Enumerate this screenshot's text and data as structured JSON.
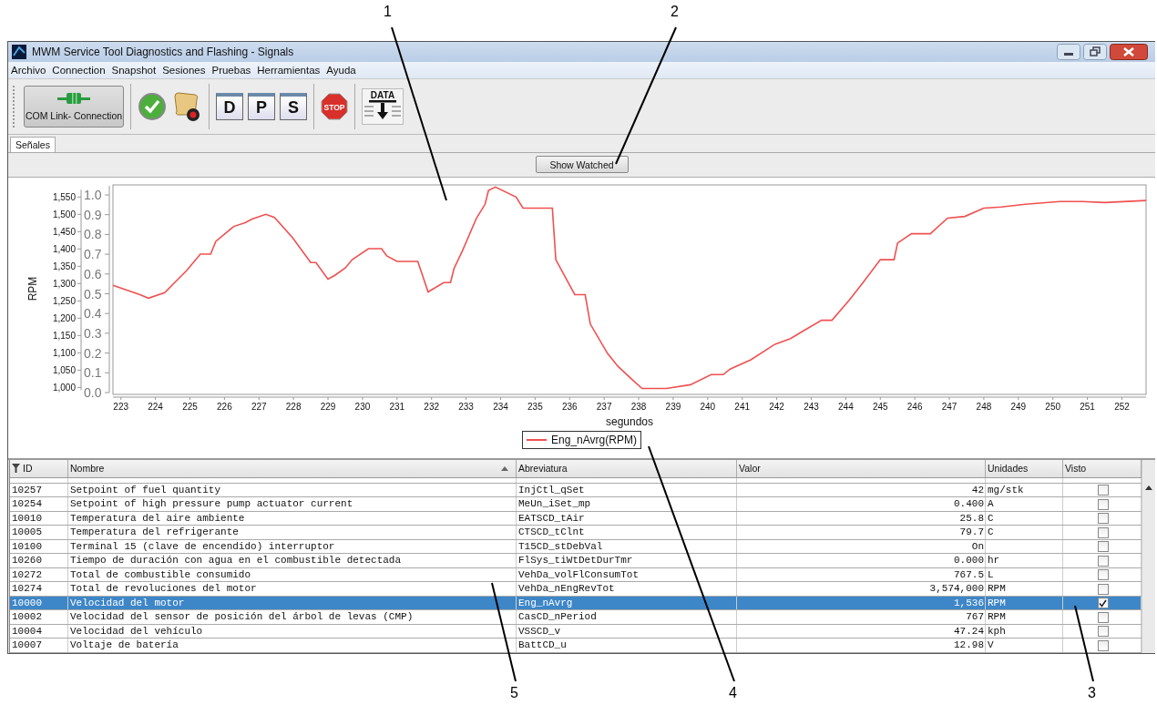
{
  "callouts": [
    {
      "label": "1"
    },
    {
      "label": "2"
    },
    {
      "label": "5"
    },
    {
      "label": "4"
    },
    {
      "label": "3"
    }
  ],
  "window": {
    "title": "MWM Service Tool Diagnostics and Flashing - Signals"
  },
  "menu": [
    "Archivo",
    "Connection",
    "Snapshot",
    "Sesiones",
    "Pruebas",
    "Herramientas",
    "Ayuda"
  ],
  "toolbar": [
    {
      "kind": "connection",
      "label": "COM Link- Connection"
    },
    {
      "kind": "check"
    },
    {
      "kind": "scroll"
    },
    {
      "kind": "letter",
      "label": "D"
    },
    {
      "kind": "letter",
      "label": "P"
    },
    {
      "kind": "letter",
      "label": "S"
    },
    {
      "kind": "stop",
      "label": "STOP"
    },
    {
      "kind": "data",
      "label": "DATA"
    }
  ],
  "tabs": [
    {
      "label": "Señales",
      "selected": true
    }
  ],
  "show_watched_button": "Show Watched",
  "chart": {
    "chart_data": {
      "type": "line",
      "xlabel": "segundos",
      "ylabel": "RPM",
      "xlim": [
        222.77,
        252.7
      ],
      "ylim": [
        980,
        1585
      ],
      "xticks": [
        223,
        224,
        225,
        226,
        227,
        228,
        229,
        230,
        231,
        232,
        233,
        234,
        235,
        236,
        237,
        238,
        239,
        240,
        241,
        242,
        243,
        244,
        245,
        246,
        247,
        248,
        249,
        250,
        251,
        252
      ],
      "yticks": [
        {
          "value": 1000,
          "label": "1,000"
        },
        {
          "value": 1050,
          "label": "1,050"
        },
        {
          "value": 1100,
          "label": "1,100"
        },
        {
          "value": 1150,
          "label": "1,150"
        },
        {
          "value": 1200,
          "label": "1,200"
        },
        {
          "value": 1250,
          "label": "1,250"
        },
        {
          "value": 1300,
          "label": "1,300"
        },
        {
          "value": 1350,
          "label": "1,350"
        },
        {
          "value": 1400,
          "label": "1,400"
        },
        {
          "value": 1450,
          "label": "1,450"
        },
        {
          "value": 1500,
          "label": "1,500"
        },
        {
          "value": 1550,
          "label": "1,550"
        }
      ],
      "y2ticks": [
        "0.0",
        "0.1",
        "0.2",
        "0.3",
        "0.4",
        "0.5",
        "0.6",
        "0.7",
        "0.8",
        "0.9",
        "1.0"
      ],
      "x": [
        222.77,
        223.55,
        223.8,
        224.27,
        224.53,
        224.9,
        225.3,
        225.6,
        225.75,
        226.27,
        226.6,
        226.8,
        227.2,
        227.45,
        227.97,
        228.5,
        228.65,
        229.0,
        229.2,
        229.5,
        229.7,
        230.17,
        230.55,
        230.7,
        231.0,
        231.6,
        231.9,
        232.35,
        232.55,
        232.65,
        232.9,
        233.3,
        233.55,
        233.65,
        233.85,
        234.45,
        234.65,
        235.5,
        235.6,
        236.15,
        236.45,
        236.6,
        237.1,
        237.4,
        237.8,
        238.1,
        238.8,
        239.5,
        240.1,
        240.45,
        240.65,
        241.25,
        241.95,
        242.4,
        242.75,
        243.3,
        243.6,
        244.1,
        244.5,
        245.0,
        245.4,
        245.5,
        245.9,
        246.45,
        246.95,
        247.45,
        248.0,
        248.5,
        249.2,
        250.2,
        250.85,
        251.5,
        252.7
      ],
      "series": [
        {
          "name": "Eng_nAvrg(RPM)",
          "color": "#f05050",
          "values": [
            1295,
            1268,
            1258,
            1274,
            1300,
            1337,
            1385,
            1385,
            1422,
            1465,
            1476,
            1486,
            1500,
            1491,
            1433,
            1361,
            1361,
            1313,
            1324,
            1345,
            1369,
            1401,
            1401,
            1380,
            1364,
            1364,
            1276,
            1303,
            1303,
            1343,
            1396,
            1489,
            1529,
            1569,
            1579,
            1550,
            1518,
            1518,
            1369,
            1268,
            1268,
            1183,
            1098,
            1061,
            1024,
            997,
            997,
            1008,
            1037,
            1037,
            1053,
            1080,
            1125,
            1141,
            1162,
            1194,
            1194,
            1252,
            1303,
            1369,
            1369,
            1417,
            1444,
            1444,
            1489,
            1494,
            1518,
            1521,
            1529,
            1537,
            1537,
            1534,
            1540
          ]
        }
      ]
    }
  },
  "table": {
    "columns": [
      "ID",
      "Nombre",
      "Abreviatura",
      "Valor",
      "Unidades",
      "Visto"
    ],
    "rows": [
      {
        "id": "10257",
        "name": "Setpoint of fuel quantity",
        "abbr": "InjCtl_qSet",
        "value": "42",
        "unit": "mg/stk",
        "selected": false,
        "checked": false
      },
      {
        "id": "10254",
        "name": "Setpoint of high pressure pump actuator current",
        "abbr": "MeUn_iSet_mp",
        "value": "0.400",
        "unit": "A",
        "selected": false,
        "checked": false
      },
      {
        "id": "10010",
        "name": "Temperatura del aire ambiente",
        "abbr": "EATSCD_tAir",
        "value": "25.8",
        "unit": "C",
        "selected": false,
        "checked": false
      },
      {
        "id": "10005",
        "name": "Temperatura del refrigerante",
        "abbr": "CTSCD_tClnt",
        "value": "79.7",
        "unit": "C",
        "selected": false,
        "checked": false
      },
      {
        "id": "10100",
        "name": "Terminal 15 (clave de encendido) interruptor",
        "abbr": "T15CD_stDebVal",
        "value": "On",
        "unit": "",
        "selected": false,
        "checked": false
      },
      {
        "id": "10260",
        "name": "Tiempo de duración con agua en el combustible detectada",
        "abbr": "FlSys_tiWtDetDurTmr",
        "value": "0.000",
        "unit": "hr",
        "selected": false,
        "checked": false
      },
      {
        "id": "10272",
        "name": "Total de combustible consumido",
        "abbr": "VehDa_volFlConsumTot",
        "value": "767.5",
        "unit": "L",
        "selected": false,
        "checked": false
      },
      {
        "id": "10274",
        "name": "Total de revoluciones del motor",
        "abbr": "VehDa_nEngRevTot",
        "value": "3,574,000",
        "unit": "RPM",
        "selected": false,
        "checked": false
      },
      {
        "id": "10000",
        "name": "Velocidad del motor",
        "abbr": "Eng_nAvrg",
        "value": "1,536",
        "unit": "RPM",
        "selected": true,
        "checked": true
      },
      {
        "id": "10002",
        "name": "Velocidad del sensor de posición del árbol de levas (CMP)",
        "abbr": "CasCD_nPeriod",
        "value": "767",
        "unit": "RPM",
        "selected": false,
        "checked": false
      },
      {
        "id": "10004",
        "name": "Velocidad del vehículo",
        "abbr": "VSSCD_v",
        "value": "47.24",
        "unit": "kph",
        "selected": false,
        "checked": false
      },
      {
        "id": "10007",
        "name": "Voltaje de batería",
        "abbr": "BattCD_u",
        "value": "12.98",
        "unit": "V",
        "selected": false,
        "checked": false
      }
    ]
  }
}
